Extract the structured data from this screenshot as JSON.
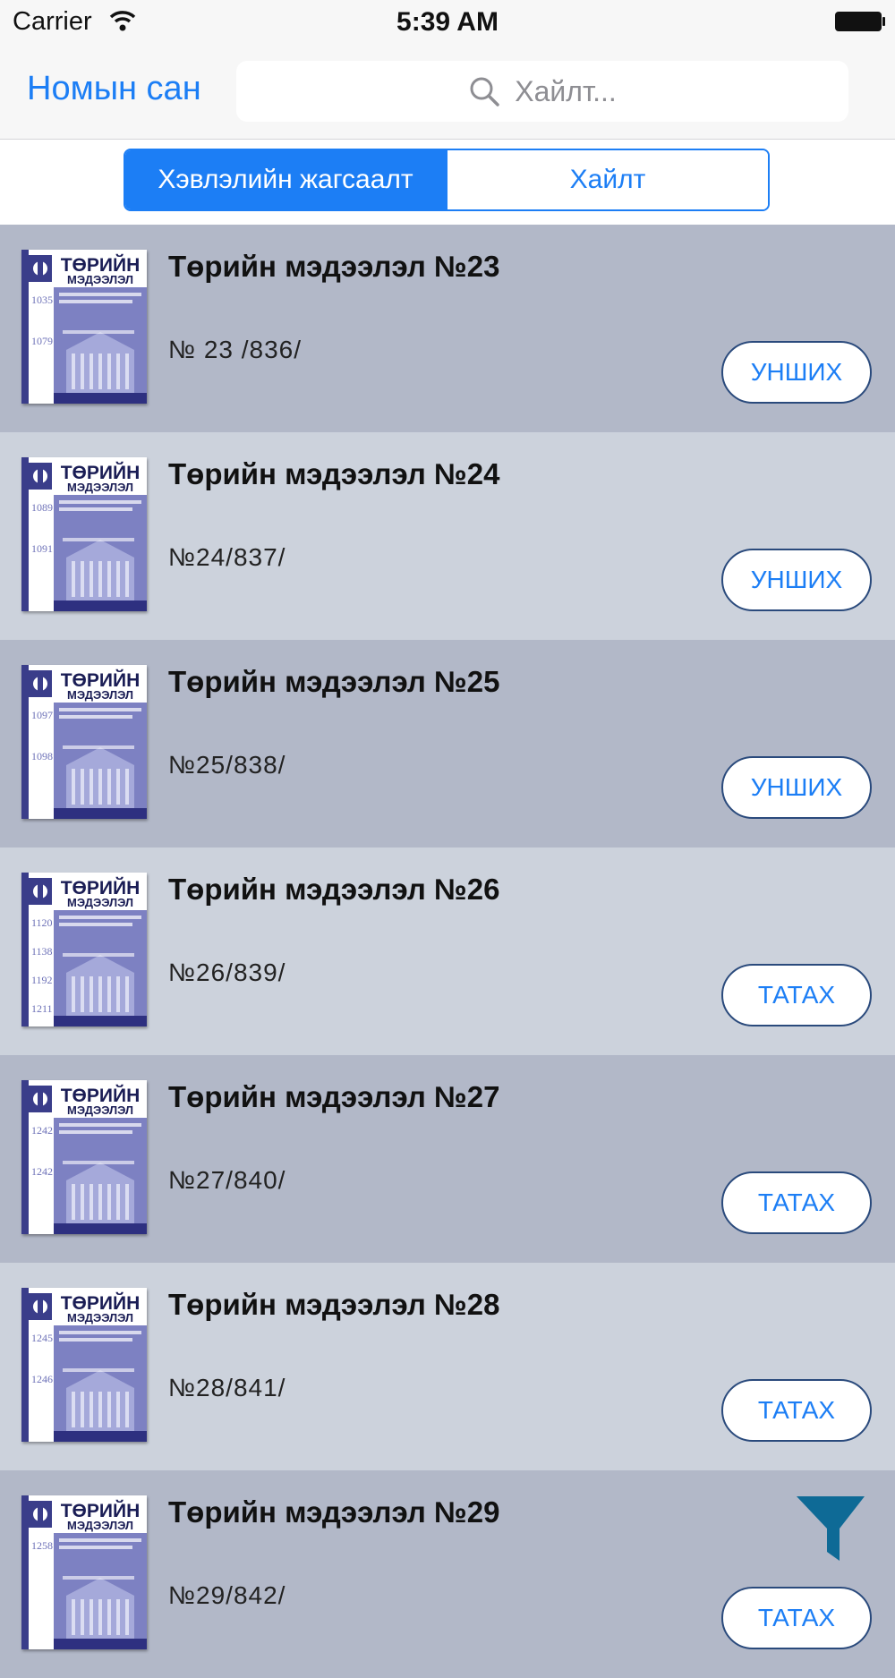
{
  "status_bar": {
    "carrier": "Carrier",
    "time": "5:39 AM"
  },
  "nav": {
    "title": "Номын сан",
    "search_placeholder": "Хайлт..."
  },
  "segments": {
    "first": "Хэвлэлийн жагсаалт",
    "second": "Хайлт"
  },
  "items": [
    {
      "title": "Төрийн мэдээлэл №23",
      "subtitle": "№ 23 /836/",
      "action": "УНШИХ",
      "cover_numbers": [
        "1035",
        "1079"
      ]
    },
    {
      "title": "Төрийн мэдээлэл №24",
      "subtitle": "№24/837/",
      "action": "УНШИХ",
      "cover_numbers": [
        "1089",
        "1091"
      ]
    },
    {
      "title": "Төрийн мэдээлэл №25",
      "subtitle": "№25/838/",
      "action": "УНШИХ",
      "cover_numbers": [
        "1097",
        "1098"
      ]
    },
    {
      "title": "Төрийн мэдээлэл №26",
      "subtitle": "№26/839/",
      "action": "ТАТАХ",
      "cover_numbers": [
        "1120",
        "1138",
        "1192",
        "1211"
      ]
    },
    {
      "title": "Төрийн мэдээлэл №27",
      "subtitle": "№27/840/",
      "action": "ТАТАХ",
      "cover_numbers": [
        "1242",
        "1242"
      ]
    },
    {
      "title": "Төрийн мэдээлэл №28",
      "subtitle": "№28/841/",
      "action": "ТАТАХ",
      "cover_numbers": [
        "1245",
        "1246"
      ]
    },
    {
      "title": "Төрийн мэдээлэл №29",
      "subtitle": "№29/842/",
      "action": "ТАТАХ",
      "cover_numbers": [
        "1258"
      ]
    }
  ],
  "cover": {
    "title_line1": "ТӨРИЙН",
    "title_line2": "МЭДЭЭЛЭЛ"
  },
  "colors": {
    "accent": "#1c7ef5",
    "row_dark": "#b2b8c8",
    "row_light": "#ccd2dc",
    "filter": "#0e6a96"
  }
}
